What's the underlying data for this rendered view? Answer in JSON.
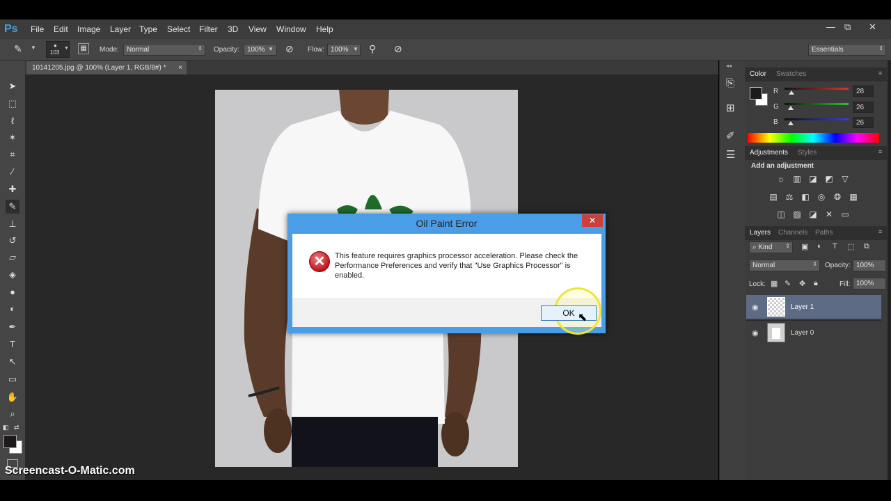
{
  "app": {
    "logo": "Ps"
  },
  "menu": [
    "File",
    "Edit",
    "Image",
    "Layer",
    "Type",
    "Select",
    "Filter",
    "3D",
    "View",
    "Window",
    "Help"
  ],
  "window_controls": {
    "minimize": "—",
    "restore": "⧉",
    "close": "✕"
  },
  "options": {
    "brush_size": "103",
    "mode_label": "Mode:",
    "mode_value": "Normal",
    "opacity_label": "Opacity:",
    "opacity_value": "100%",
    "flow_label": "Flow:",
    "flow_value": "100%",
    "workspace": "Essentials"
  },
  "document_tab": {
    "title": "10141205.jpg @ 100% (Layer 1, RGB/8#) *",
    "close": "×"
  },
  "color_panel": {
    "tabs": [
      "Color",
      "Swatches"
    ],
    "channels": [
      {
        "label": "R",
        "value": "28",
        "color": "#e03030"
      },
      {
        "label": "G",
        "value": "26",
        "color": "#30c030"
      },
      {
        "label": "B",
        "value": "26",
        "color": "#3040e0"
      }
    ]
  },
  "adjustments_panel": {
    "tabs": [
      "Adjustments",
      "Styles"
    ],
    "heading": "Add an adjustment"
  },
  "layers_panel": {
    "tabs": [
      "Layers",
      "Channels",
      "Paths"
    ],
    "kind_filter": "Kind",
    "blend_mode": "Normal",
    "opacity_label": "Opacity:",
    "opacity_value": "100%",
    "lock_label": "Lock:",
    "fill_label": "Fill:",
    "fill_value": "100%",
    "layers": [
      {
        "name": "Layer 1",
        "selected": true
      },
      {
        "name": "Layer 0",
        "selected": false
      }
    ]
  },
  "dialog": {
    "title": "Oil Paint Error",
    "close": "✕",
    "message": "This feature requires graphics processor acceleration. Please check the Performance Preferences and verify that \"Use Graphics Processor\" is enabled.",
    "ok_label": "OK"
  },
  "watermark": "Screencast-O-Matic.com"
}
